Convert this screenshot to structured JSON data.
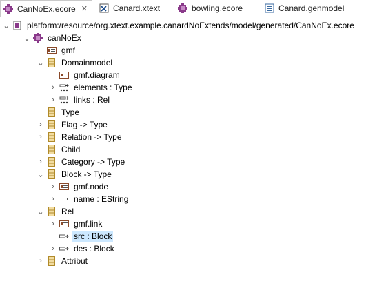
{
  "tabs": [
    {
      "label": "CanNoEx.ecore",
      "close": "✕",
      "active": true,
      "icon": "ecore-icon"
    },
    {
      "label": "Canard.xtext",
      "active": false,
      "icon": "xtext-icon"
    },
    {
      "label": "bowling.ecore",
      "active": false,
      "icon": "ecore-icon"
    },
    {
      "label": "Canard.genmodel",
      "active": false,
      "icon": "genmodel-icon"
    }
  ],
  "tree": {
    "resource": "platform:/resource/org.xtext.example.canardNoExtends/model/generated/CanNoEx.ecore",
    "package": "canNoEx",
    "items": [
      {
        "label": "gmf",
        "icon": "annotation-icon"
      },
      {
        "label": "Domainmodel",
        "icon": "eclass-icon"
      },
      {
        "label": "gmf.diagram",
        "icon": "annotation-icon"
      },
      {
        "label": "elements : Type",
        "icon": "containment-ref-icon"
      },
      {
        "label": "links : Rel",
        "icon": "containment-ref-icon"
      },
      {
        "label": "Type",
        "icon": "eclass-icon"
      },
      {
        "label": "Flag -> Type",
        "icon": "eclass-icon"
      },
      {
        "label": "Relation -> Type",
        "icon": "eclass-icon"
      },
      {
        "label": "Child",
        "icon": "eclass-icon"
      },
      {
        "label": "Category -> Type",
        "icon": "eclass-icon"
      },
      {
        "label": "Block -> Type",
        "icon": "eclass-icon"
      },
      {
        "label": "gmf.node",
        "icon": "annotation-icon"
      },
      {
        "label": "name : EString",
        "icon": "eattribute-icon"
      },
      {
        "label": "Rel",
        "icon": "eclass-icon"
      },
      {
        "label": "gmf.link",
        "icon": "annotation-icon"
      },
      {
        "label": "src : Block",
        "icon": "ereference-icon"
      },
      {
        "label": "des : Block",
        "icon": "ereference-icon"
      },
      {
        "label": "Attribut",
        "icon": "eclass-icon"
      }
    ],
    "selected_item": "src : Block",
    "colors": {
      "selection": "#cce8ff",
      "class_icon": "#c9a24a",
      "package_icon": "#8a3a8a"
    }
  }
}
